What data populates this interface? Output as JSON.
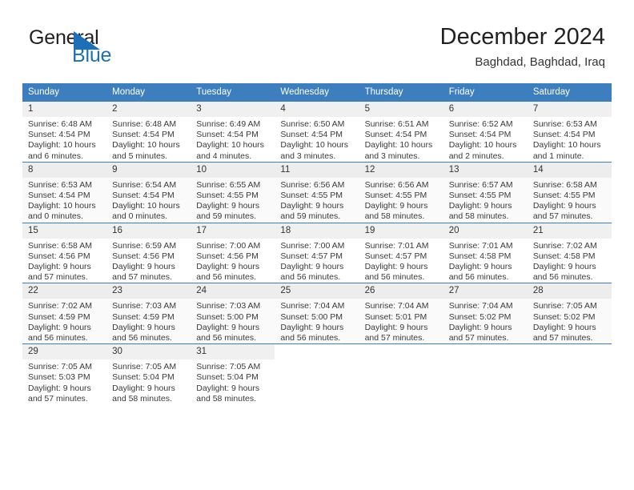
{
  "brand": {
    "word1": "General",
    "word2": "Blue",
    "triangle_color": "#1b70b8",
    "text_color": "#231f20"
  },
  "header": {
    "title": "December 2024",
    "subtitle": "Baghdad, Baghdad, Iraq"
  },
  "theme": {
    "header_blue": "#3d7ebf",
    "daynum_band": "#f0f0f0",
    "grid_line": "#3d7ebf",
    "text": "#3a3a3a"
  },
  "weekdays": [
    "Sunday",
    "Monday",
    "Tuesday",
    "Wednesday",
    "Thursday",
    "Friday",
    "Saturday"
  ],
  "labels": {
    "sunrise": "Sunrise:",
    "sunset": "Sunset:",
    "daylight": "Daylight:"
  },
  "weeks": [
    [
      {
        "day": "1",
        "sunrise": "Sunrise: 6:48 AM",
        "sunset": "Sunset: 4:54 PM",
        "daylight1": "Daylight: 10 hours",
        "daylight2": "and 6 minutes."
      },
      {
        "day": "2",
        "sunrise": "Sunrise: 6:48 AM",
        "sunset": "Sunset: 4:54 PM",
        "daylight1": "Daylight: 10 hours",
        "daylight2": "and 5 minutes."
      },
      {
        "day": "3",
        "sunrise": "Sunrise: 6:49 AM",
        "sunset": "Sunset: 4:54 PM",
        "daylight1": "Daylight: 10 hours",
        "daylight2": "and 4 minutes."
      },
      {
        "day": "4",
        "sunrise": "Sunrise: 6:50 AM",
        "sunset": "Sunset: 4:54 PM",
        "daylight1": "Daylight: 10 hours",
        "daylight2": "and 3 minutes."
      },
      {
        "day": "5",
        "sunrise": "Sunrise: 6:51 AM",
        "sunset": "Sunset: 4:54 PM",
        "daylight1": "Daylight: 10 hours",
        "daylight2": "and 3 minutes."
      },
      {
        "day": "6",
        "sunrise": "Sunrise: 6:52 AM",
        "sunset": "Sunset: 4:54 PM",
        "daylight1": "Daylight: 10 hours",
        "daylight2": "and 2 minutes."
      },
      {
        "day": "7",
        "sunrise": "Sunrise: 6:53 AM",
        "sunset": "Sunset: 4:54 PM",
        "daylight1": "Daylight: 10 hours",
        "daylight2": "and 1 minute."
      }
    ],
    [
      {
        "day": "8",
        "sunrise": "Sunrise: 6:53 AM",
        "sunset": "Sunset: 4:54 PM",
        "daylight1": "Daylight: 10 hours",
        "daylight2": "and 0 minutes."
      },
      {
        "day": "9",
        "sunrise": "Sunrise: 6:54 AM",
        "sunset": "Sunset: 4:54 PM",
        "daylight1": "Daylight: 10 hours",
        "daylight2": "and 0 minutes."
      },
      {
        "day": "10",
        "sunrise": "Sunrise: 6:55 AM",
        "sunset": "Sunset: 4:55 PM",
        "daylight1": "Daylight: 9 hours",
        "daylight2": "and 59 minutes."
      },
      {
        "day": "11",
        "sunrise": "Sunrise: 6:56 AM",
        "sunset": "Sunset: 4:55 PM",
        "daylight1": "Daylight: 9 hours",
        "daylight2": "and 59 minutes."
      },
      {
        "day": "12",
        "sunrise": "Sunrise: 6:56 AM",
        "sunset": "Sunset: 4:55 PM",
        "daylight1": "Daylight: 9 hours",
        "daylight2": "and 58 minutes."
      },
      {
        "day": "13",
        "sunrise": "Sunrise: 6:57 AM",
        "sunset": "Sunset: 4:55 PM",
        "daylight1": "Daylight: 9 hours",
        "daylight2": "and 58 minutes."
      },
      {
        "day": "14",
        "sunrise": "Sunrise: 6:58 AM",
        "sunset": "Sunset: 4:55 PM",
        "daylight1": "Daylight: 9 hours",
        "daylight2": "and 57 minutes."
      }
    ],
    [
      {
        "day": "15",
        "sunrise": "Sunrise: 6:58 AM",
        "sunset": "Sunset: 4:56 PM",
        "daylight1": "Daylight: 9 hours",
        "daylight2": "and 57 minutes."
      },
      {
        "day": "16",
        "sunrise": "Sunrise: 6:59 AM",
        "sunset": "Sunset: 4:56 PM",
        "daylight1": "Daylight: 9 hours",
        "daylight2": "and 57 minutes."
      },
      {
        "day": "17",
        "sunrise": "Sunrise: 7:00 AM",
        "sunset": "Sunset: 4:56 PM",
        "daylight1": "Daylight: 9 hours",
        "daylight2": "and 56 minutes."
      },
      {
        "day": "18",
        "sunrise": "Sunrise: 7:00 AM",
        "sunset": "Sunset: 4:57 PM",
        "daylight1": "Daylight: 9 hours",
        "daylight2": "and 56 minutes."
      },
      {
        "day": "19",
        "sunrise": "Sunrise: 7:01 AM",
        "sunset": "Sunset: 4:57 PM",
        "daylight1": "Daylight: 9 hours",
        "daylight2": "and 56 minutes."
      },
      {
        "day": "20",
        "sunrise": "Sunrise: 7:01 AM",
        "sunset": "Sunset: 4:58 PM",
        "daylight1": "Daylight: 9 hours",
        "daylight2": "and 56 minutes."
      },
      {
        "day": "21",
        "sunrise": "Sunrise: 7:02 AM",
        "sunset": "Sunset: 4:58 PM",
        "daylight1": "Daylight: 9 hours",
        "daylight2": "and 56 minutes."
      }
    ],
    [
      {
        "day": "22",
        "sunrise": "Sunrise: 7:02 AM",
        "sunset": "Sunset: 4:59 PM",
        "daylight1": "Daylight: 9 hours",
        "daylight2": "and 56 minutes."
      },
      {
        "day": "23",
        "sunrise": "Sunrise: 7:03 AM",
        "sunset": "Sunset: 4:59 PM",
        "daylight1": "Daylight: 9 hours",
        "daylight2": "and 56 minutes."
      },
      {
        "day": "24",
        "sunrise": "Sunrise: 7:03 AM",
        "sunset": "Sunset: 5:00 PM",
        "daylight1": "Daylight: 9 hours",
        "daylight2": "and 56 minutes."
      },
      {
        "day": "25",
        "sunrise": "Sunrise: 7:04 AM",
        "sunset": "Sunset: 5:00 PM",
        "daylight1": "Daylight: 9 hours",
        "daylight2": "and 56 minutes."
      },
      {
        "day": "26",
        "sunrise": "Sunrise: 7:04 AM",
        "sunset": "Sunset: 5:01 PM",
        "daylight1": "Daylight: 9 hours",
        "daylight2": "and 57 minutes."
      },
      {
        "day": "27",
        "sunrise": "Sunrise: 7:04 AM",
        "sunset": "Sunset: 5:02 PM",
        "daylight1": "Daylight: 9 hours",
        "daylight2": "and 57 minutes."
      },
      {
        "day": "28",
        "sunrise": "Sunrise: 7:05 AM",
        "sunset": "Sunset: 5:02 PM",
        "daylight1": "Daylight: 9 hours",
        "daylight2": "and 57 minutes."
      }
    ],
    [
      {
        "day": "29",
        "sunrise": "Sunrise: 7:05 AM",
        "sunset": "Sunset: 5:03 PM",
        "daylight1": "Daylight: 9 hours",
        "daylight2": "and 57 minutes."
      },
      {
        "day": "30",
        "sunrise": "Sunrise: 7:05 AM",
        "sunset": "Sunset: 5:04 PM",
        "daylight1": "Daylight: 9 hours",
        "daylight2": "and 58 minutes."
      },
      {
        "day": "31",
        "sunrise": "Sunrise: 7:05 AM",
        "sunset": "Sunset: 5:04 PM",
        "daylight1": "Daylight: 9 hours",
        "daylight2": "and 58 minutes."
      },
      {
        "day": "",
        "sunrise": "",
        "sunset": "",
        "daylight1": "",
        "daylight2": ""
      },
      {
        "day": "",
        "sunrise": "",
        "sunset": "",
        "daylight1": "",
        "daylight2": ""
      },
      {
        "day": "",
        "sunrise": "",
        "sunset": "",
        "daylight1": "",
        "daylight2": ""
      },
      {
        "day": "",
        "sunrise": "",
        "sunset": "",
        "daylight1": "",
        "daylight2": ""
      }
    ]
  ]
}
